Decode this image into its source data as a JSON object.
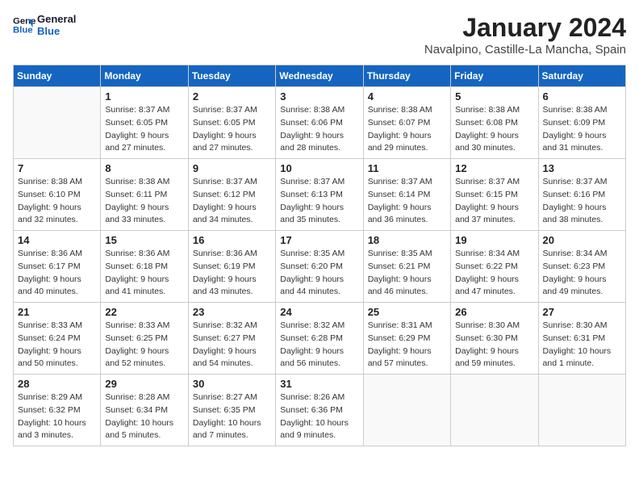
{
  "header": {
    "logo_line1": "General",
    "logo_line2": "Blue",
    "month": "January 2024",
    "location": "Navalpino, Castille-La Mancha, Spain"
  },
  "weekdays": [
    "Sunday",
    "Monday",
    "Tuesday",
    "Wednesday",
    "Thursday",
    "Friday",
    "Saturday"
  ],
  "weeks": [
    [
      {
        "day": "",
        "sunrise": "",
        "sunset": "",
        "daylight": ""
      },
      {
        "day": "1",
        "sunrise": "Sunrise: 8:37 AM",
        "sunset": "Sunset: 6:05 PM",
        "daylight": "Daylight: 9 hours and 27 minutes."
      },
      {
        "day": "2",
        "sunrise": "Sunrise: 8:37 AM",
        "sunset": "Sunset: 6:05 PM",
        "daylight": "Daylight: 9 hours and 27 minutes."
      },
      {
        "day": "3",
        "sunrise": "Sunrise: 8:38 AM",
        "sunset": "Sunset: 6:06 PM",
        "daylight": "Daylight: 9 hours and 28 minutes."
      },
      {
        "day": "4",
        "sunrise": "Sunrise: 8:38 AM",
        "sunset": "Sunset: 6:07 PM",
        "daylight": "Daylight: 9 hours and 29 minutes."
      },
      {
        "day": "5",
        "sunrise": "Sunrise: 8:38 AM",
        "sunset": "Sunset: 6:08 PM",
        "daylight": "Daylight: 9 hours and 30 minutes."
      },
      {
        "day": "6",
        "sunrise": "Sunrise: 8:38 AM",
        "sunset": "Sunset: 6:09 PM",
        "daylight": "Daylight: 9 hours and 31 minutes."
      }
    ],
    [
      {
        "day": "7",
        "sunrise": "Sunrise: 8:38 AM",
        "sunset": "Sunset: 6:10 PM",
        "daylight": "Daylight: 9 hours and 32 minutes."
      },
      {
        "day": "8",
        "sunrise": "Sunrise: 8:38 AM",
        "sunset": "Sunset: 6:11 PM",
        "daylight": "Daylight: 9 hours and 33 minutes."
      },
      {
        "day": "9",
        "sunrise": "Sunrise: 8:37 AM",
        "sunset": "Sunset: 6:12 PM",
        "daylight": "Daylight: 9 hours and 34 minutes."
      },
      {
        "day": "10",
        "sunrise": "Sunrise: 8:37 AM",
        "sunset": "Sunset: 6:13 PM",
        "daylight": "Daylight: 9 hours and 35 minutes."
      },
      {
        "day": "11",
        "sunrise": "Sunrise: 8:37 AM",
        "sunset": "Sunset: 6:14 PM",
        "daylight": "Daylight: 9 hours and 36 minutes."
      },
      {
        "day": "12",
        "sunrise": "Sunrise: 8:37 AM",
        "sunset": "Sunset: 6:15 PM",
        "daylight": "Daylight: 9 hours and 37 minutes."
      },
      {
        "day": "13",
        "sunrise": "Sunrise: 8:37 AM",
        "sunset": "Sunset: 6:16 PM",
        "daylight": "Daylight: 9 hours and 38 minutes."
      }
    ],
    [
      {
        "day": "14",
        "sunrise": "Sunrise: 8:36 AM",
        "sunset": "Sunset: 6:17 PM",
        "daylight": "Daylight: 9 hours and 40 minutes."
      },
      {
        "day": "15",
        "sunrise": "Sunrise: 8:36 AM",
        "sunset": "Sunset: 6:18 PM",
        "daylight": "Daylight: 9 hours and 41 minutes."
      },
      {
        "day": "16",
        "sunrise": "Sunrise: 8:36 AM",
        "sunset": "Sunset: 6:19 PM",
        "daylight": "Daylight: 9 hours and 43 minutes."
      },
      {
        "day": "17",
        "sunrise": "Sunrise: 8:35 AM",
        "sunset": "Sunset: 6:20 PM",
        "daylight": "Daylight: 9 hours and 44 minutes."
      },
      {
        "day": "18",
        "sunrise": "Sunrise: 8:35 AM",
        "sunset": "Sunset: 6:21 PM",
        "daylight": "Daylight: 9 hours and 46 minutes."
      },
      {
        "day": "19",
        "sunrise": "Sunrise: 8:34 AM",
        "sunset": "Sunset: 6:22 PM",
        "daylight": "Daylight: 9 hours and 47 minutes."
      },
      {
        "day": "20",
        "sunrise": "Sunrise: 8:34 AM",
        "sunset": "Sunset: 6:23 PM",
        "daylight": "Daylight: 9 hours and 49 minutes."
      }
    ],
    [
      {
        "day": "21",
        "sunrise": "Sunrise: 8:33 AM",
        "sunset": "Sunset: 6:24 PM",
        "daylight": "Daylight: 9 hours and 50 minutes."
      },
      {
        "day": "22",
        "sunrise": "Sunrise: 8:33 AM",
        "sunset": "Sunset: 6:25 PM",
        "daylight": "Daylight: 9 hours and 52 minutes."
      },
      {
        "day": "23",
        "sunrise": "Sunrise: 8:32 AM",
        "sunset": "Sunset: 6:27 PM",
        "daylight": "Daylight: 9 hours and 54 minutes."
      },
      {
        "day": "24",
        "sunrise": "Sunrise: 8:32 AM",
        "sunset": "Sunset: 6:28 PM",
        "daylight": "Daylight: 9 hours and 56 minutes."
      },
      {
        "day": "25",
        "sunrise": "Sunrise: 8:31 AM",
        "sunset": "Sunset: 6:29 PM",
        "daylight": "Daylight: 9 hours and 57 minutes."
      },
      {
        "day": "26",
        "sunrise": "Sunrise: 8:30 AM",
        "sunset": "Sunset: 6:30 PM",
        "daylight": "Daylight: 9 hours and 59 minutes."
      },
      {
        "day": "27",
        "sunrise": "Sunrise: 8:30 AM",
        "sunset": "Sunset: 6:31 PM",
        "daylight": "Daylight: 10 hours and 1 minute."
      }
    ],
    [
      {
        "day": "28",
        "sunrise": "Sunrise: 8:29 AM",
        "sunset": "Sunset: 6:32 PM",
        "daylight": "Daylight: 10 hours and 3 minutes."
      },
      {
        "day": "29",
        "sunrise": "Sunrise: 8:28 AM",
        "sunset": "Sunset: 6:34 PM",
        "daylight": "Daylight: 10 hours and 5 minutes."
      },
      {
        "day": "30",
        "sunrise": "Sunrise: 8:27 AM",
        "sunset": "Sunset: 6:35 PM",
        "daylight": "Daylight: 10 hours and 7 minutes."
      },
      {
        "day": "31",
        "sunrise": "Sunrise: 8:26 AM",
        "sunset": "Sunset: 6:36 PM",
        "daylight": "Daylight: 10 hours and 9 minutes."
      },
      {
        "day": "",
        "sunrise": "",
        "sunset": "",
        "daylight": ""
      },
      {
        "day": "",
        "sunrise": "",
        "sunset": "",
        "daylight": ""
      },
      {
        "day": "",
        "sunrise": "",
        "sunset": "",
        "daylight": ""
      }
    ]
  ]
}
